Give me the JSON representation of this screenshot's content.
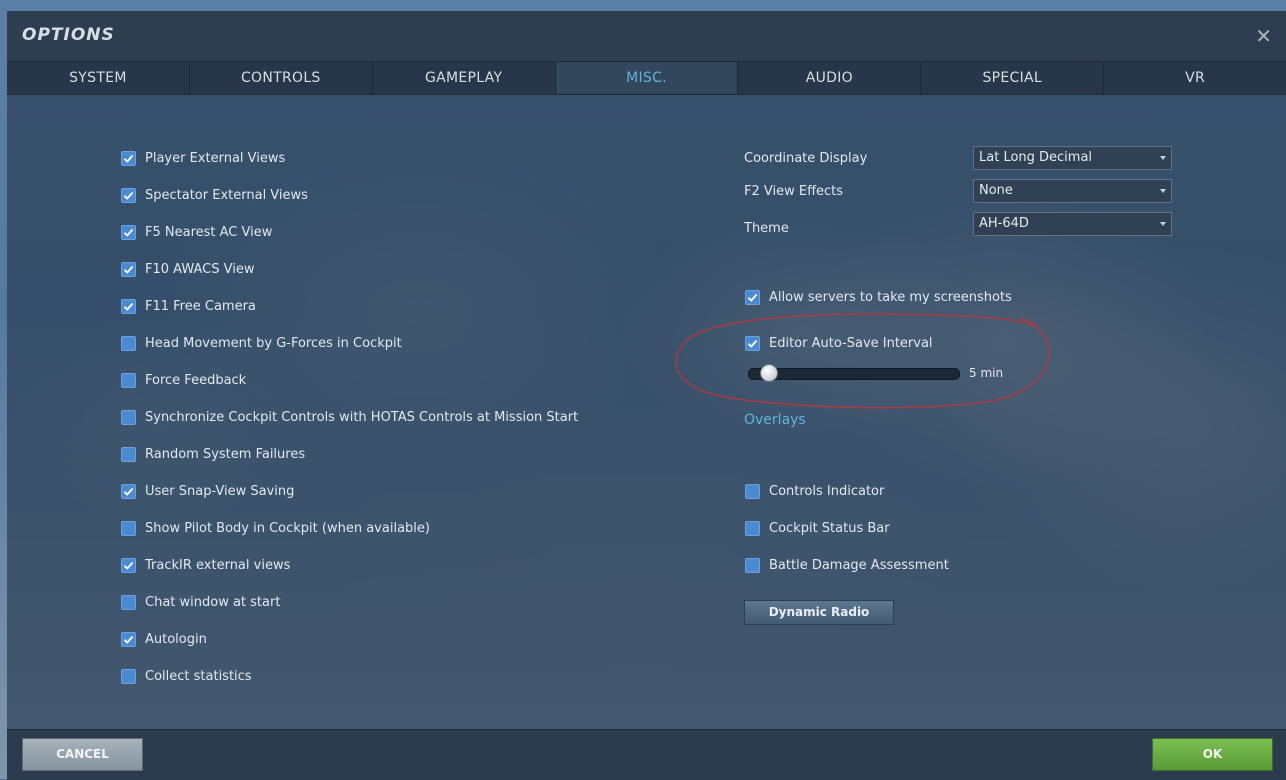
{
  "dialog": {
    "title": "OPTIONS",
    "close_symbol": "✕"
  },
  "tabs": [
    {
      "label": "SYSTEM"
    },
    {
      "label": "CONTROLS"
    },
    {
      "label": "GAMEPLAY"
    },
    {
      "label": "MISC.",
      "active": true
    },
    {
      "label": "AUDIO"
    },
    {
      "label": "SPECIAL"
    },
    {
      "label": "VR"
    }
  ],
  "left_options": [
    {
      "label": "Player External Views",
      "checked": true
    },
    {
      "label": "Spectator External Views",
      "checked": true
    },
    {
      "label": "F5 Nearest AC View",
      "checked": true
    },
    {
      "label": "F10 AWACS View",
      "checked": true
    },
    {
      "label": "F11 Free Camera",
      "checked": true
    },
    {
      "label": "Head Movement by G-Forces in Cockpit",
      "checked": false
    },
    {
      "label": "Force Feedback",
      "checked": false
    },
    {
      "label": "Synchronize Cockpit Controls with HOTAS Controls at Mission Start",
      "checked": false
    },
    {
      "label": "Random System Failures",
      "checked": false
    },
    {
      "label": "User Snap-View Saving",
      "checked": true
    },
    {
      "label": "Show Pilot Body in Cockpit (when available)",
      "checked": false
    },
    {
      "label": "TrackIR external views",
      "checked": true
    },
    {
      "label": "Chat window at start",
      "checked": false
    },
    {
      "label": "Autologin",
      "checked": true
    },
    {
      "label": "Collect statistics",
      "checked": false
    }
  ],
  "right_selects": [
    {
      "label": "Coordinate Display",
      "value": "Lat Long Decimal"
    },
    {
      "label": "F2 View Effects",
      "value": "None"
    },
    {
      "label": "Theme",
      "value": "AH-64D"
    }
  ],
  "screenshots_option": {
    "label": "Allow servers to take my screenshots",
    "checked": true
  },
  "autosave": {
    "label": "Editor Auto-Save Interval",
    "checked": true,
    "slider_fraction": 0.09,
    "value_text": "5 min"
  },
  "overlays": {
    "label": "Overlays",
    "options": [
      {
        "label": "Controls Indicator",
        "checked": false
      },
      {
        "label": "Cockpit Status Bar",
        "checked": false
      },
      {
        "label": "Battle Damage Assessment",
        "checked": false
      }
    ]
  },
  "dynamic_radio_label": "Dynamic Radio",
  "footer": {
    "cancel_label": "CANCEL",
    "ok_label": "OK"
  },
  "colors": {
    "accent": "#5fb4da",
    "ok": "#6aad44",
    "annotation": "#b03a3f"
  }
}
